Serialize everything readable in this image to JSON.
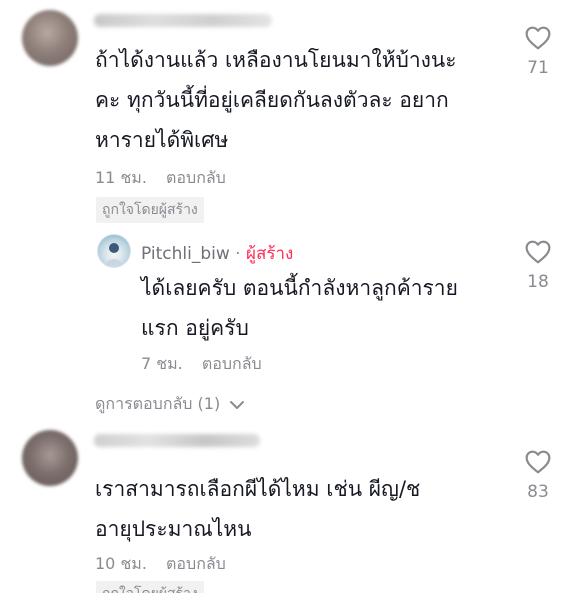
{
  "comments": [
    {
      "text_lines": [
        "ถ้าได้งานแล้ว เหลืองานโยนมาให้บ้างนะ",
        "คะ ทุกวันนี้ที่อยู่เคลียดกันลงตัวละ อยาก",
        "หารายได้พิเศษ"
      ],
      "time": "11 ชม.",
      "reply_label": "ตอบกลับ",
      "liked_badge": "ถูกใจโดยผู้สร้าง",
      "like_count": "71",
      "replies": [
        {
          "username": "Pitchli_biw",
          "separator": "·",
          "creator_label": "ผู้สร้าง",
          "text_lines": [
            "ได้เลยครับ ตอนนี้กำลังหาลูกค้าราย",
            "แรก อยู่ครับ"
          ],
          "time": "7 ชม.",
          "reply_label": "ตอบกลับ",
          "like_count": "18"
        }
      ],
      "view_replies_label": "ดูการตอบกลับ (1)"
    },
    {
      "text_lines": [
        "เราสามารถเลือกผีได้ไหม เช่น ผีญ/ช",
        "อายุประมาณไหน"
      ],
      "time": "10 ชม.",
      "reply_label": "ตอบกลับ",
      "liked_badge": "ถูกใจโดยผู้สร้าง",
      "like_count": "83"
    }
  ],
  "colors": {
    "text": "#161823",
    "secondary": "#8a8b91",
    "creator": "#fe2c55",
    "badge_bg": "#f1f1f2"
  },
  "icons": {
    "like": "heart-outline-icon",
    "expand": "chevron-down-icon"
  }
}
